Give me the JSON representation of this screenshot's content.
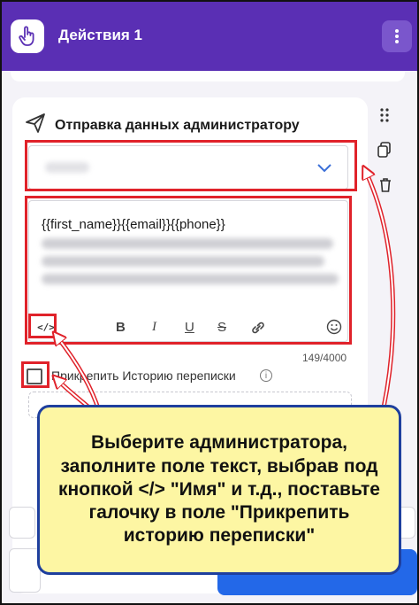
{
  "header": {
    "title": "Действия 1",
    "hand_icon": "hand-pointer-icon",
    "menu_icon": "vertical-dots-icon"
  },
  "card": {
    "title": "Отправка данных администратору",
    "title_icon": "send-icon"
  },
  "select": {
    "value_blurred": true,
    "chevron_icon": "chevron-down-icon"
  },
  "editor": {
    "first_line": "{{first_name}}{{email}}{{phone}}",
    "toolbar": {
      "code": "</>",
      "bold": "B",
      "italic": "I",
      "underline": "U",
      "strike": "S"
    },
    "counter": "149/4000"
  },
  "checkbox": {
    "label": "Прикрепить Историю переписки",
    "checked": false
  },
  "side_tools": [
    "drag-handle-icon",
    "copy-icon",
    "delete-icon"
  ],
  "callout": {
    "text": "Выберите администратора, заполните поле текст, выбрав под кнопкой </> \"Имя\" и т.д., поставьте галочку в поле \"Прикрепить историю переписки\""
  },
  "colors": {
    "header": "#5a2fb4",
    "highlight": "#e0222a",
    "callout_bg": "#fdf6a3",
    "callout_border": "#1e3f9e"
  }
}
